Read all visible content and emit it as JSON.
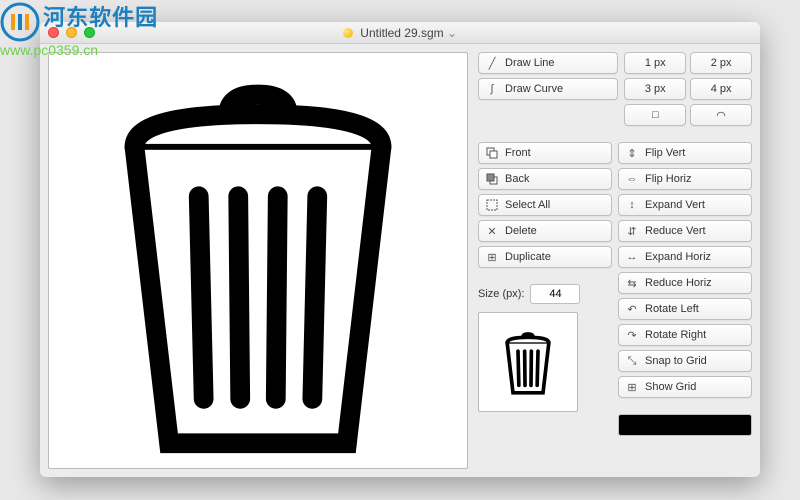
{
  "watermark": {
    "text": "河东软件园",
    "url": "www.pc0359.cn"
  },
  "window": {
    "title": "Untitled 29.sgm",
    "dropdown_glyph": "⌄"
  },
  "tools_top": {
    "draw_line": "Draw Line",
    "draw_curve": "Draw Curve",
    "px1": "1 px",
    "px2": "2 px",
    "px3": "3 px",
    "px4": "4 px",
    "shape_square": "□",
    "shape_arch": "◠"
  },
  "arrange": {
    "front": "Front",
    "back": "Back",
    "select_all": "Select All",
    "delete": "Delete",
    "duplicate": "Duplicate"
  },
  "transform": {
    "flip_vert": "Flip Vert",
    "flip_horiz": "Flip Horiz",
    "expand_vert": "Expand Vert",
    "reduce_vert": "Reduce Vert",
    "expand_horiz": "Expand Horiz",
    "reduce_horiz": "Reduce Horiz",
    "rotate_left": "Rotate Left",
    "rotate_right": "Rotate Right",
    "snap_to_grid": "Snap to Grid",
    "show_grid": "Show Grid"
  },
  "size": {
    "label": "Size (px):",
    "value": "44"
  },
  "color": "#000000"
}
